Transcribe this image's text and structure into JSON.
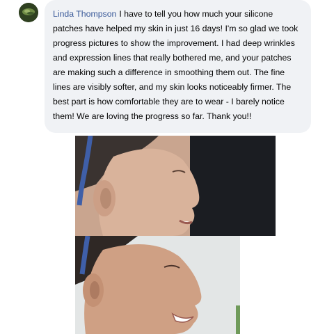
{
  "comment": {
    "author": "Linda Thompson",
    "text": "I have to tell you how much your silicone patches have helped my skin in just 16 days! I'm so glad we took progress pictures to show the improvement. I had deep wrinkles and expression lines that really bothered me, and your patches are making such a difference in smoothing them out. The fine lines are visibly softer, and my skin looks noticeably firmer. The best part is how comfortable they are to wear - I barely notice them! We are loving the progress so far. Thank you!!"
  },
  "colors": {
    "author_link": "#385898",
    "bubble_background": "#f0f2f5",
    "text": "#050505"
  },
  "photos": [
    {
      "position": "top",
      "subject": "face-profile-before"
    },
    {
      "position": "bottom",
      "subject": "face-profile-after"
    }
  ]
}
